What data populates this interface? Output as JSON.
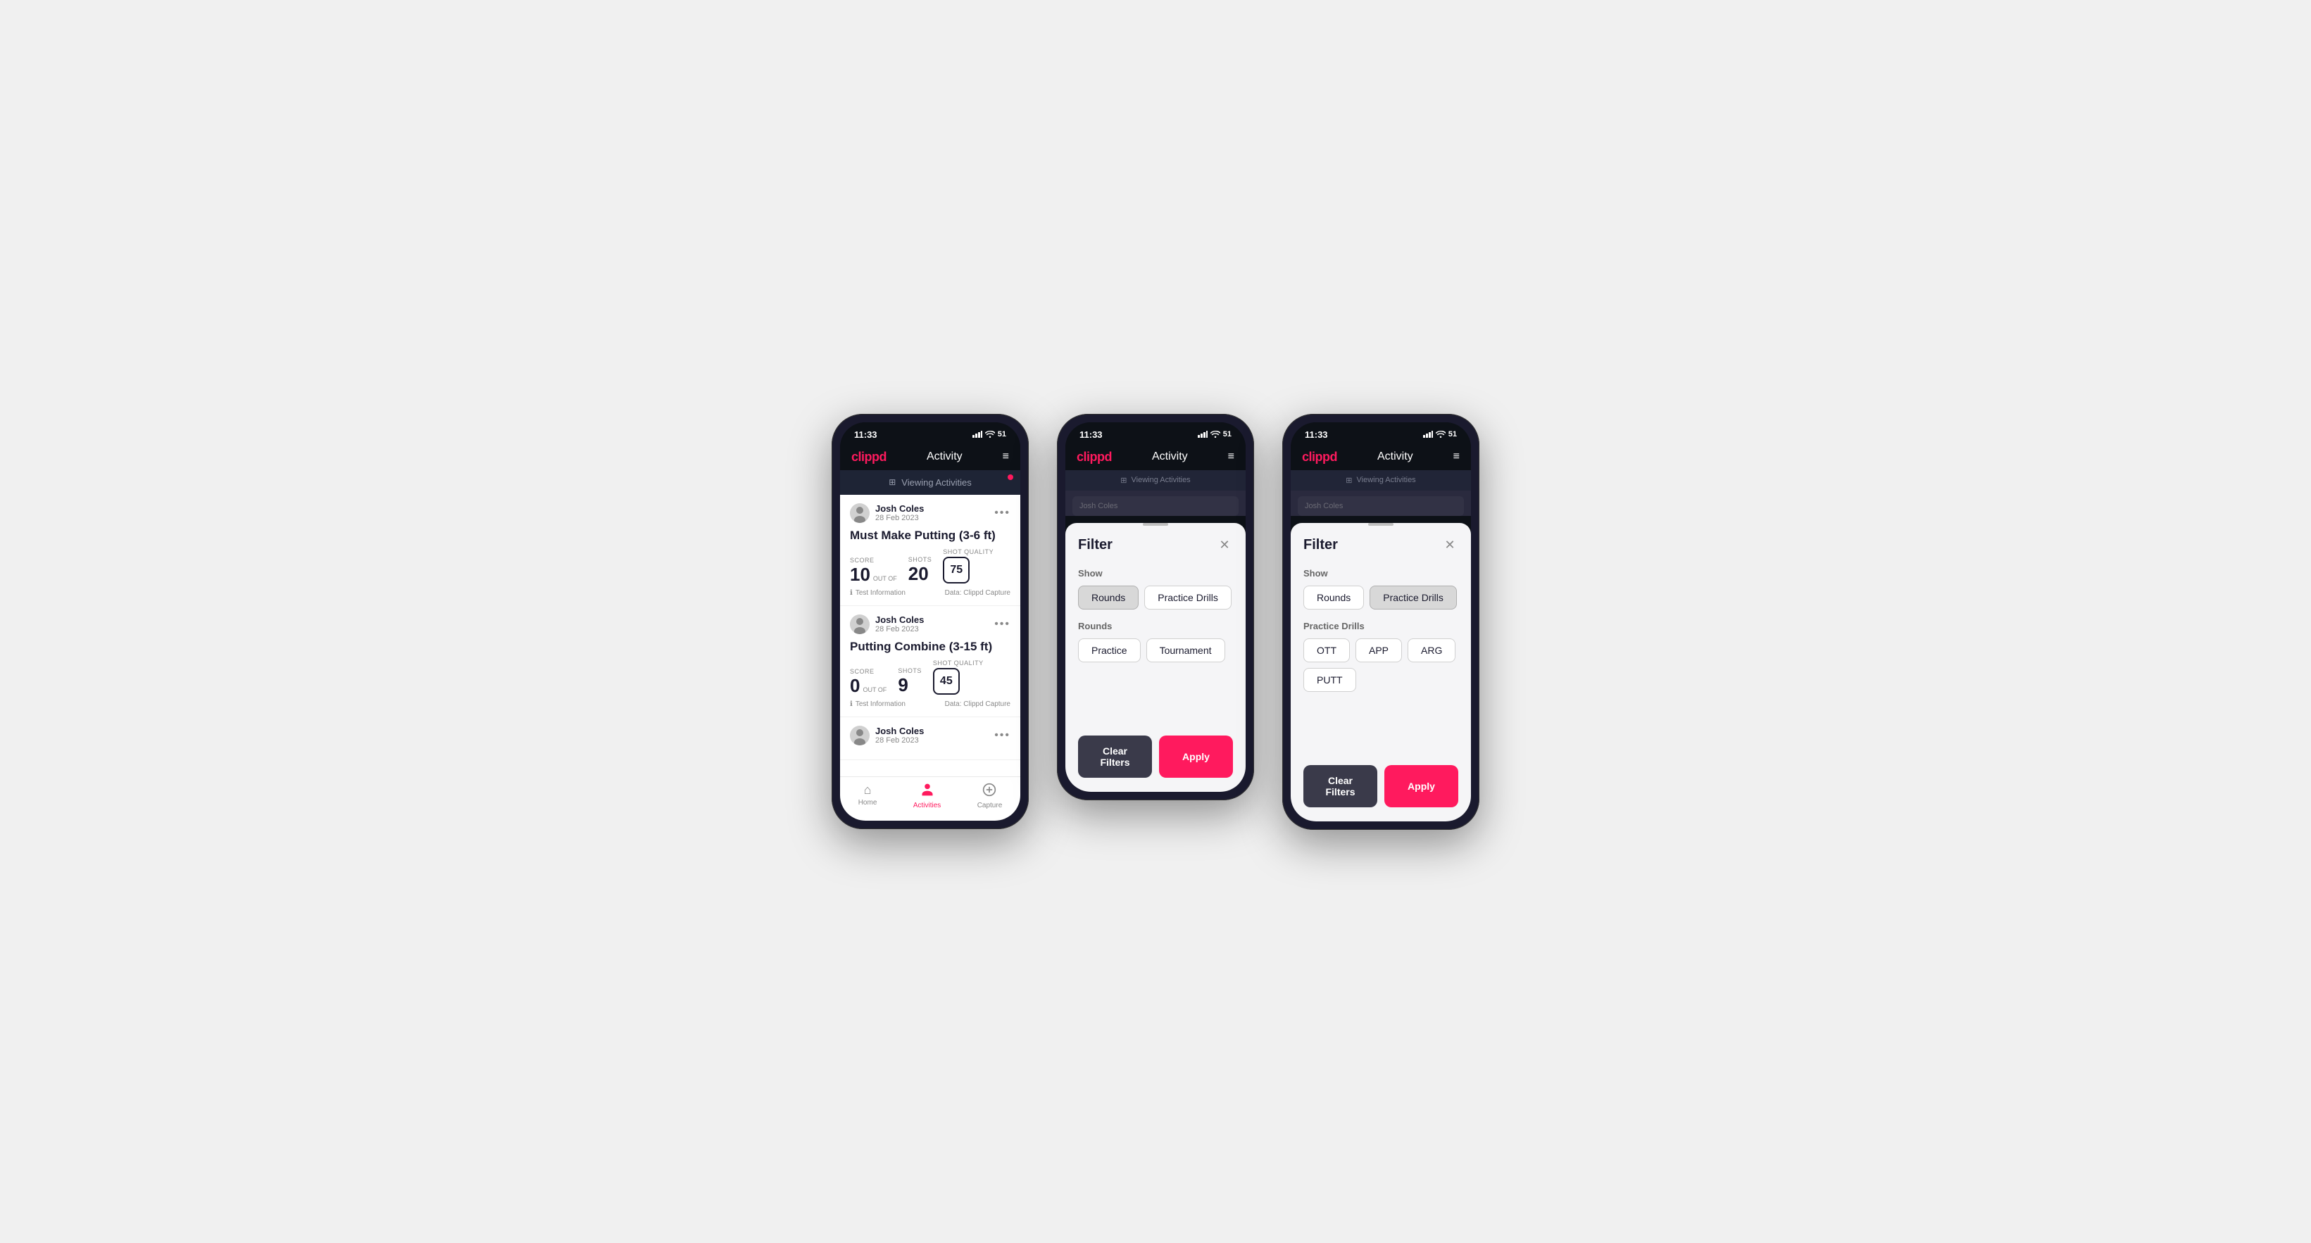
{
  "phones": [
    {
      "id": "phone1",
      "status_bar": {
        "time": "11:33",
        "battery": "51"
      },
      "header": {
        "logo": "clippd",
        "title": "Activity",
        "menu": "≡"
      },
      "viewing_bar": {
        "text": "Viewing Activities",
        "has_dot": true
      },
      "cards": [
        {
          "user_name": "Josh Coles",
          "user_date": "28 Feb 2023",
          "title": "Must Make Putting (3-6 ft)",
          "score_label": "Score",
          "score_value": "10",
          "out_of_text": "OUT OF",
          "shots_label": "Shots",
          "shots_value": "20",
          "shot_quality_label": "Shot Quality",
          "shot_quality_value": "75",
          "footer_info": "Test Information",
          "footer_data": "Data: Clippd Capture"
        },
        {
          "user_name": "Josh Coles",
          "user_date": "28 Feb 2023",
          "title": "Putting Combine (3-15 ft)",
          "score_label": "Score",
          "score_value": "0",
          "out_of_text": "OUT OF",
          "shots_label": "Shots",
          "shots_value": "9",
          "shot_quality_label": "Shot Quality",
          "shot_quality_value": "45",
          "footer_info": "Test Information",
          "footer_data": "Data: Clippd Capture"
        },
        {
          "user_name": "Josh Coles",
          "user_date": "28 Feb 2023",
          "title": "",
          "partial": true
        }
      ],
      "bottom_nav": [
        {
          "label": "Home",
          "icon": "⌂",
          "active": false
        },
        {
          "label": "Activities",
          "icon": "♟",
          "active": true
        },
        {
          "label": "Capture",
          "icon": "+",
          "active": false
        }
      ]
    },
    {
      "id": "phone2",
      "status_bar": {
        "time": "11:33",
        "battery": "51"
      },
      "header": {
        "logo": "clippd",
        "title": "Activity",
        "menu": "≡"
      },
      "viewing_bar": {
        "text": "Viewing Activities",
        "has_dot": true
      },
      "filter": {
        "title": "Filter",
        "show_section": {
          "label": "Show",
          "buttons": [
            {
              "label": "Rounds",
              "active": true
            },
            {
              "label": "Practice Drills",
              "active": false
            }
          ]
        },
        "rounds_section": {
          "label": "Rounds",
          "buttons": [
            {
              "label": "Practice",
              "active": false
            },
            {
              "label": "Tournament",
              "active": false
            }
          ]
        },
        "actions": {
          "clear_label": "Clear Filters",
          "apply_label": "Apply"
        }
      }
    },
    {
      "id": "phone3",
      "status_bar": {
        "time": "11:33",
        "battery": "51"
      },
      "header": {
        "logo": "clippd",
        "title": "Activity",
        "menu": "≡"
      },
      "viewing_bar": {
        "text": "Viewing Activities",
        "has_dot": true
      },
      "filter": {
        "title": "Filter",
        "show_section": {
          "label": "Show",
          "buttons": [
            {
              "label": "Rounds",
              "active": false
            },
            {
              "label": "Practice Drills",
              "active": true
            }
          ]
        },
        "practice_drills_section": {
          "label": "Practice Drills",
          "buttons": [
            {
              "label": "OTT",
              "active": false
            },
            {
              "label": "APP",
              "active": false
            },
            {
              "label": "ARG",
              "active": false
            },
            {
              "label": "PUTT",
              "active": false
            }
          ]
        },
        "actions": {
          "clear_label": "Clear Filters",
          "apply_label": "Apply"
        }
      }
    }
  ],
  "colors": {
    "brand_red": "#ff1a5e",
    "dark_bg": "#0d1117",
    "card_bg": "#1e2435",
    "text_dark": "#1a1a2e",
    "text_muted": "#888888"
  }
}
